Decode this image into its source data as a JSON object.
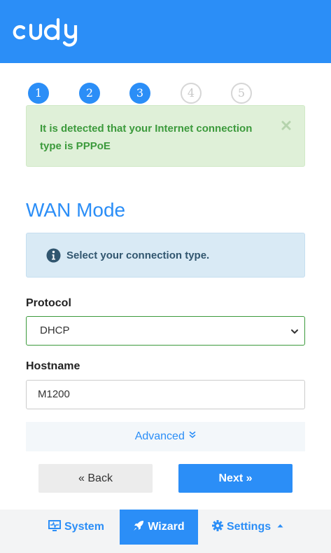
{
  "brand": {
    "logo_text": "cudy",
    "accent": "#2b8ef7"
  },
  "steps": [
    "1",
    "2",
    "3",
    "4",
    "5"
  ],
  "steps_completed": 3,
  "notice": {
    "message": "It is detected that your Internet connection type is PPPoE",
    "close_icon": "close-icon"
  },
  "page": {
    "title": "WAN Mode"
  },
  "info": {
    "icon": "info-circle-icon",
    "text": "Select your connection type."
  },
  "form": {
    "protocol_label": "Protocol",
    "protocol_value": "DHCP",
    "hostname_label": "Hostname",
    "hostname_value": "M1200"
  },
  "advanced": {
    "label": "Advanced"
  },
  "buttons": {
    "back": "« Back",
    "next": "Next »"
  },
  "footer": {
    "system": "System",
    "wizard": "Wizard",
    "settings": "Settings"
  }
}
